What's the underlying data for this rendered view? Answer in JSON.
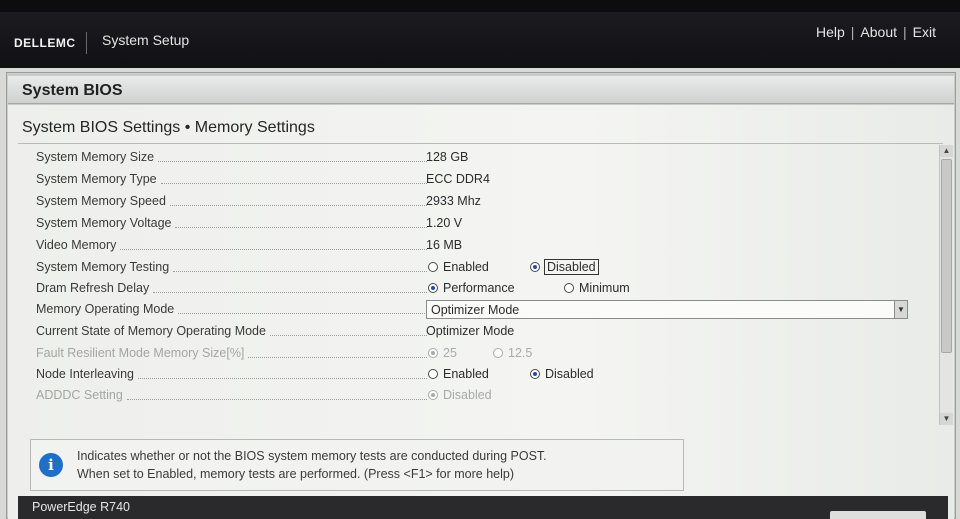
{
  "brand": {
    "logo": "DELLEMC",
    "app_title": "System Setup"
  },
  "top_links": [
    "Help",
    "About",
    "Exit"
  ],
  "page_title": "System BIOS",
  "breadcrumb": "System BIOS Settings • Memory Settings",
  "settings": [
    {
      "label": "System Memory Size",
      "type": "text",
      "value": "128 GB"
    },
    {
      "label": "System Memory Type",
      "type": "text",
      "value": "ECC DDR4"
    },
    {
      "label": "System Memory Speed",
      "type": "text",
      "value": "2933 Mhz"
    },
    {
      "label": "System Memory Voltage",
      "type": "text",
      "value": "1.20 V"
    },
    {
      "label": "Video Memory",
      "type": "text",
      "value": "16 MB"
    },
    {
      "label": "System Memory Testing",
      "type": "radio",
      "options": [
        "Enabled",
        "Disabled"
      ],
      "selected": "Disabled"
    },
    {
      "label": "Dram Refresh Delay",
      "type": "radio",
      "options": [
        "Performance",
        "Minimum"
      ],
      "selected": "Performance"
    },
    {
      "label": "Memory Operating Mode",
      "type": "dropdown",
      "value": "Optimizer Mode"
    },
    {
      "label": "Current State of Memory Operating Mode",
      "type": "text",
      "value": "Optimizer Mode"
    },
    {
      "label": "Fault Resilient Mode Memory Size[%]",
      "type": "radio",
      "options": [
        "25",
        "12.5"
      ],
      "selected": "25",
      "disabled": true
    },
    {
      "label": "Node Interleaving",
      "type": "radio",
      "options": [
        "Enabled",
        "Disabled"
      ],
      "selected": "Disabled"
    },
    {
      "label": "ADDDC Setting",
      "type": "radio",
      "options": [
        "Disabled"
      ],
      "selected": "Disabled",
      "disabled": true
    }
  ],
  "help": {
    "line1": "Indicates whether or not the BIOS system memory tests are conducted during POST.",
    "line2": "When set to Enabled, memory tests are performed. (Press <F1> for more help)"
  },
  "footer": {
    "model": "PowerEdge R740"
  },
  "colors": {
    "topbar": "#141417",
    "radio_selected": "#1e4fa8",
    "info_icon": "#1f6fc4"
  }
}
